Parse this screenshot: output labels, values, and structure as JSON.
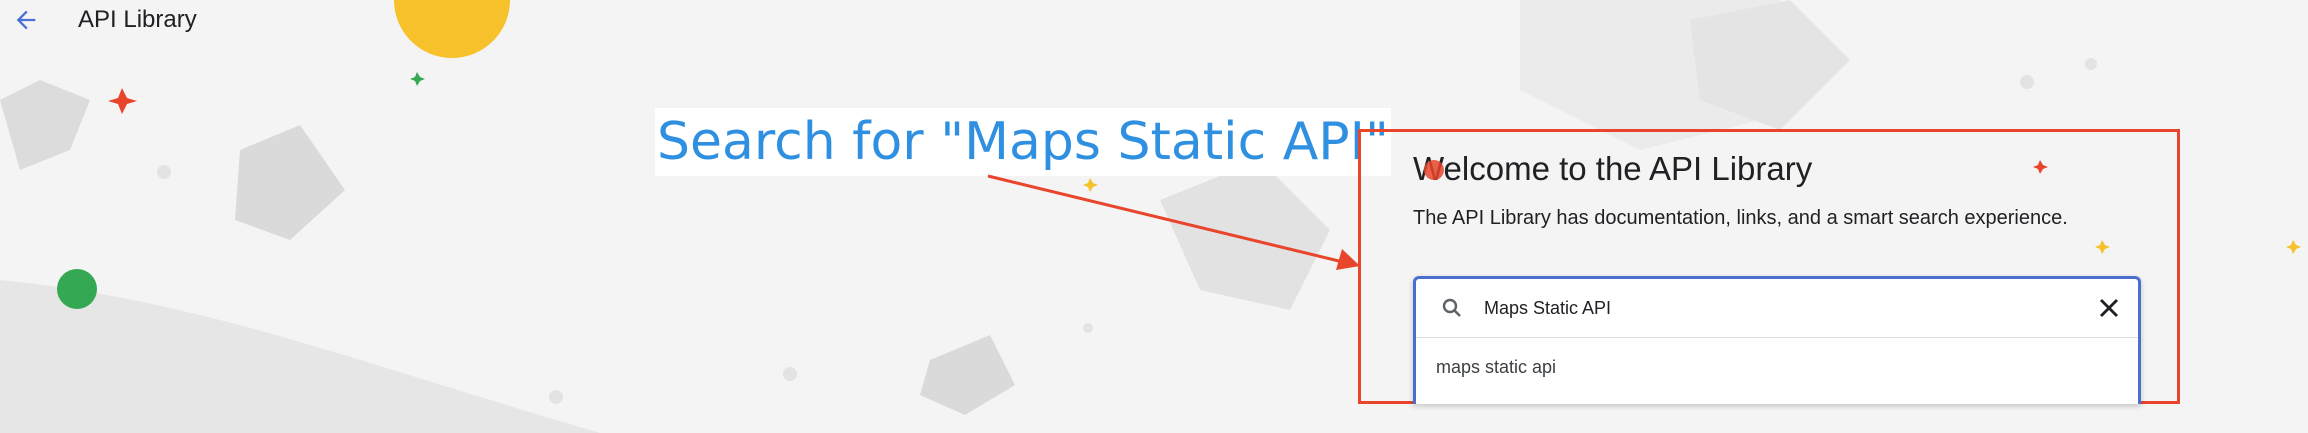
{
  "header": {
    "back_icon": "arrow-back-icon",
    "title": "API Library"
  },
  "annotation": {
    "text": "Search for \"Maps Static API\"",
    "text_color": "#2f8fe0",
    "arrow_color": "#e8452c",
    "highlight_color": "#e8452c"
  },
  "welcome": {
    "title": "Welcome to the API Library",
    "subtitle": "The API Library has documentation, links, and a smart search experience."
  },
  "search": {
    "icon": "search-icon",
    "value": "Maps Static API",
    "clear_icon": "close-icon",
    "suggestions": [
      {
        "label": "maps static api"
      }
    ]
  }
}
